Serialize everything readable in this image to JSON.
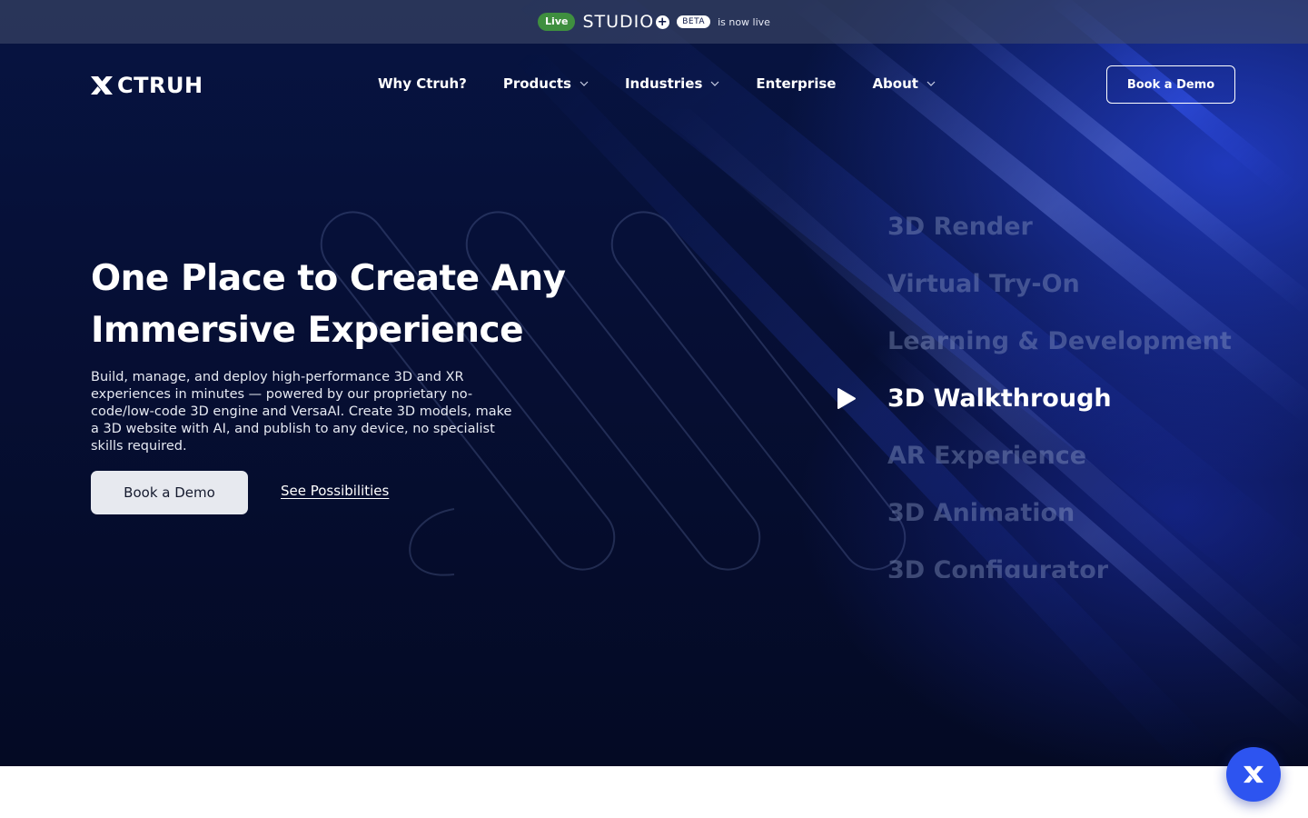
{
  "announcement": {
    "live_label": "Live",
    "product_name": "STUDIO",
    "beta_label": "BETA",
    "message": "is now live"
  },
  "brand": {
    "name": "CTRUH"
  },
  "nav": {
    "items": [
      {
        "label": "Why Ctruh?",
        "has_dropdown": false
      },
      {
        "label": "Products",
        "has_dropdown": true
      },
      {
        "label": "Industries",
        "has_dropdown": true
      },
      {
        "label": "Enterprise",
        "has_dropdown": false
      },
      {
        "label": "About",
        "has_dropdown": true
      }
    ],
    "cta_label": "Book a Demo"
  },
  "hero": {
    "headline_line1": "One Place to Create Any",
    "headline_line2": "Immersive Experience",
    "description": "Build, manage, and deploy high-performance 3D and XR experiences in minutes — powered by our proprietary no-code/low-code 3D engine and VersaAI. Create 3D models, make a 3D website with AI, and publish to any device, no specialist skills required.",
    "primary_button": "Book a Demo",
    "secondary_link": "See Possibilities"
  },
  "features": {
    "items": [
      "3D Render",
      "Virtual Try-On",
      "Learning & Development",
      "3D Walkthrough",
      "AR Experience",
      "3D Animation",
      "3D Configurator"
    ],
    "active_index": 3
  },
  "icons": {
    "play": "play-icon",
    "chevron": "chevron-down-icon",
    "logo": "ctruh-logo-icon",
    "chat": "chat-launcher-icon"
  },
  "colors": {
    "live_green": "#3f8f3f",
    "hero_navy": "#060f35",
    "accent_blue": "#2d54f0"
  }
}
